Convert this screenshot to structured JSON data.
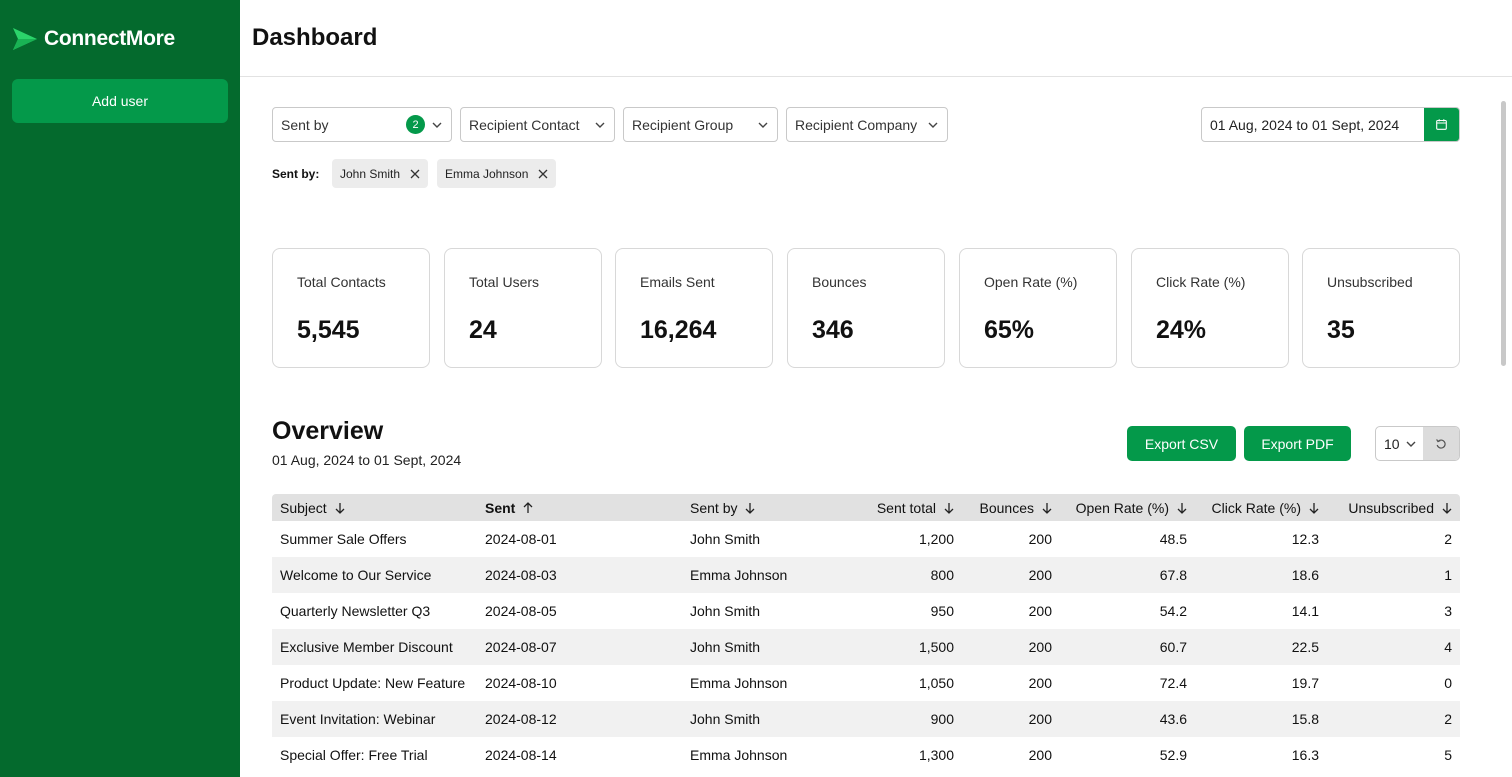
{
  "app": {
    "name": "ConnectMore",
    "brand_color": "#04994a",
    "sidebar_color": "#046a2d"
  },
  "sidebar": {
    "add_user_label": "Add user"
  },
  "header": {
    "title": "Dashboard"
  },
  "filters": {
    "sent_by": {
      "label": "Sent by",
      "count": "2"
    },
    "recipient_contact": {
      "label": "Recipient Contact"
    },
    "recipient_group": {
      "label": "Recipient Group"
    },
    "recipient_company": {
      "label": "Recipient Company"
    },
    "date_range": "01 Aug, 2024 to 01 Sept, 2024",
    "active_label": "Sent by:",
    "chips": [
      {
        "label": "John Smith"
      },
      {
        "label": "Emma Johnson"
      }
    ]
  },
  "stats": [
    {
      "label": "Total Contacts",
      "value": "5,545"
    },
    {
      "label": "Total Users",
      "value": "24"
    },
    {
      "label": "Emails Sent",
      "value": "16,264"
    },
    {
      "label": "Bounces",
      "value": "346"
    },
    {
      "label": "Open Rate (%)",
      "value": "65%"
    },
    {
      "label": "Click Rate (%)",
      "value": "24%"
    },
    {
      "label": "Unsubscribed",
      "value": "35"
    }
  ],
  "overview": {
    "title": "Overview",
    "subtitle": "01 Aug, 2024 to 01 Sept, 2024",
    "export_csv": "Export CSV",
    "export_pdf": "Export PDF",
    "page_size": "10"
  },
  "table": {
    "columns": [
      {
        "label": "Subject",
        "sort": "desc",
        "active": false
      },
      {
        "label": "Sent",
        "sort": "asc",
        "active": true
      },
      {
        "label": "Sent by",
        "sort": "desc",
        "active": false
      },
      {
        "label": "Sent total",
        "sort": "desc",
        "active": false
      },
      {
        "label": "Bounces",
        "sort": "desc",
        "active": false
      },
      {
        "label": "Open Rate (%)",
        "sort": "desc",
        "active": false
      },
      {
        "label": "Click Rate (%)",
        "sort": "desc",
        "active": false
      },
      {
        "label": "Unsubscribed",
        "sort": "desc",
        "active": false
      }
    ],
    "rows": [
      [
        "Summer Sale Offers",
        "2024-08-01",
        "John Smith",
        "1,200",
        "200",
        "48.5",
        "12.3",
        "2"
      ],
      [
        "Welcome to Our Service",
        "2024-08-03",
        "Emma Johnson",
        "800",
        "200",
        "67.8",
        "18.6",
        "1"
      ],
      [
        "Quarterly Newsletter Q3",
        "2024-08-05",
        "John Smith",
        "950",
        "200",
        "54.2",
        "14.1",
        "3"
      ],
      [
        "Exclusive Member Discount",
        "2024-08-07",
        "John Smith",
        "1,500",
        "200",
        "60.7",
        "22.5",
        "4"
      ],
      [
        "Product Update: New Feature",
        "2024-08-10",
        "Emma Johnson",
        "1,050",
        "200",
        "72.4",
        "19.7",
        "0"
      ],
      [
        "Event Invitation: Webinar",
        "2024-08-12",
        "John Smith",
        "900",
        "200",
        "43.6",
        "15.8",
        "2"
      ],
      [
        "Special Offer: Free Trial",
        "2024-08-14",
        "Emma Johnson",
        "1,300",
        "200",
        "52.9",
        "16.3",
        "5"
      ]
    ]
  }
}
